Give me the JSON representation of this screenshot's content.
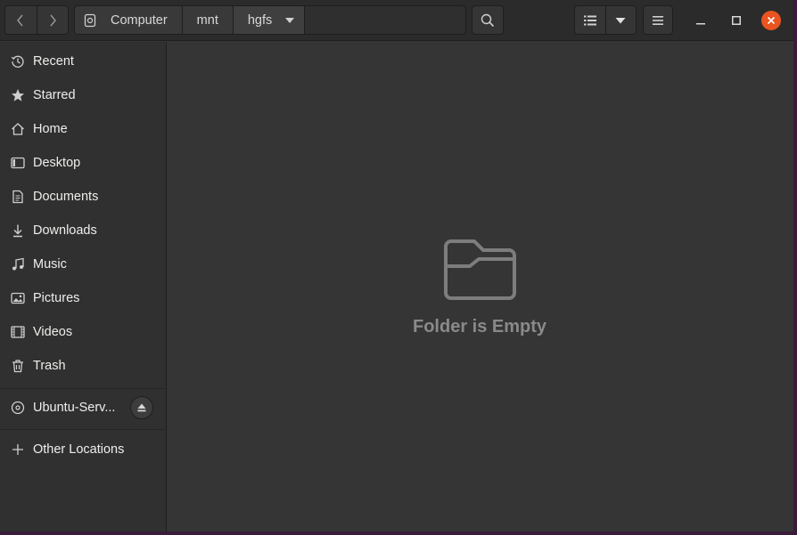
{
  "window": {
    "title": "hgfs",
    "accent": "#e95420"
  },
  "header": {
    "breadcrumbs": [
      {
        "label": "Computer",
        "icon": "drive-icon"
      },
      {
        "label": "mnt"
      },
      {
        "label": "hgfs",
        "icon": "chevron-down-icon"
      }
    ]
  },
  "sidebar": {
    "items": [
      {
        "label": "Recent",
        "icon": "clock-icon"
      },
      {
        "label": "Starred",
        "icon": "star-icon"
      },
      {
        "label": "Home",
        "icon": "home-icon"
      },
      {
        "label": "Desktop",
        "icon": "desktop-icon"
      },
      {
        "label": "Documents",
        "icon": "document-icon"
      },
      {
        "label": "Downloads",
        "icon": "download-icon"
      },
      {
        "label": "Music",
        "icon": "music-icon"
      },
      {
        "label": "Pictures",
        "icon": "picture-icon"
      },
      {
        "label": "Videos",
        "icon": "video-icon"
      },
      {
        "label": "Trash",
        "icon": "trash-icon"
      }
    ],
    "devices": [
      {
        "label": "Ubuntu-Serv...",
        "icon": "disc-icon"
      }
    ],
    "other": {
      "label": "Other Locations",
      "icon": "plus-icon"
    }
  },
  "main": {
    "empty_message": "Folder is Empty"
  }
}
